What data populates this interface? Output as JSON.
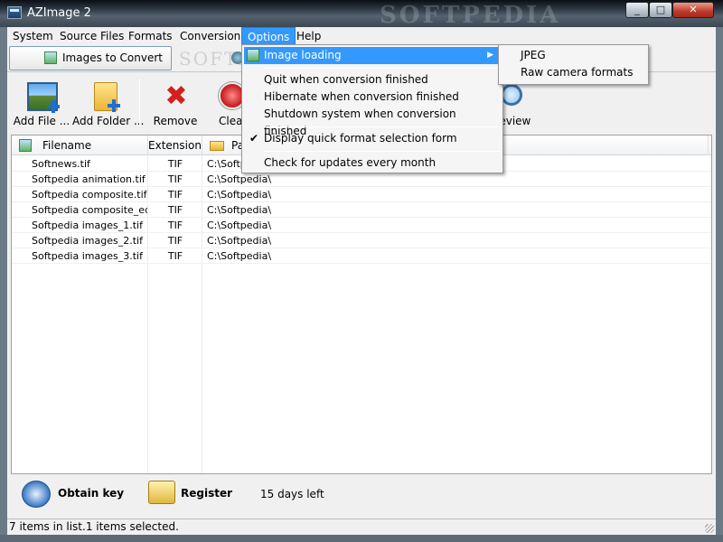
{
  "window": {
    "title": "AZImage 2",
    "watermark": "SOFTPEDIA",
    "minimize": "_",
    "maximize": "□",
    "close": "✕"
  },
  "menubar": [
    "System",
    "Source Files",
    "Formats",
    "Conversion",
    "Options",
    "Help"
  ],
  "mode_tabs": {
    "active": "Images to Convert",
    "watermark": "SOFTPEDIA"
  },
  "toolbar": {
    "add_file": "Add File ...",
    "add_folder": "Add Folder ...",
    "remove": "Remove",
    "clear": "Clear",
    "preview": "Preview"
  },
  "list": {
    "columns": [
      "Filename",
      "Extension",
      "Path"
    ],
    "rows": [
      {
        "name": "Softnews.tif",
        "ext": "TIF",
        "path": "C:\\Softpedia\\"
      },
      {
        "name": "Softpedia animation.tif",
        "ext": "TIF",
        "path": "C:\\Softpedia\\"
      },
      {
        "name": "Softpedia composite.tif",
        "ext": "TIF",
        "path": "C:\\Softpedia\\"
      },
      {
        "name": "Softpedia composite_edi...",
        "ext": "TIF",
        "path": "C:\\Softpedia\\"
      },
      {
        "name": "Softpedia images_1.tif",
        "ext": "TIF",
        "path": "C:\\Softpedia\\"
      },
      {
        "name": "Softpedia images_2.tif",
        "ext": "TIF",
        "path": "C:\\Softpedia\\"
      },
      {
        "name": "Softpedia images_3.tif",
        "ext": "TIF",
        "path": "C:\\Softpedia\\"
      }
    ]
  },
  "bottom": {
    "obtain_key": "Obtain key",
    "register": "Register",
    "days_left": "15 days left"
  },
  "status": {
    "text": "7 items in list.1 items selected."
  },
  "options_menu": {
    "image_loading": "Image loading",
    "quit": "Quit when conversion finished",
    "hibernate": "Hibernate when conversion finished",
    "shutdown": "Shutdown system when conversion finished",
    "quick_format": "Display quick format selection form",
    "quick_format_checked": true,
    "check_updates": "Check for updates every month",
    "check_mark": "✔",
    "sub_arrow": "▶"
  },
  "image_loading_submenu": [
    "JPEG",
    "Raw camera formats"
  ],
  "colors": {
    "highlight": "#3399ff",
    "window_bg": "#f0f0f0"
  }
}
